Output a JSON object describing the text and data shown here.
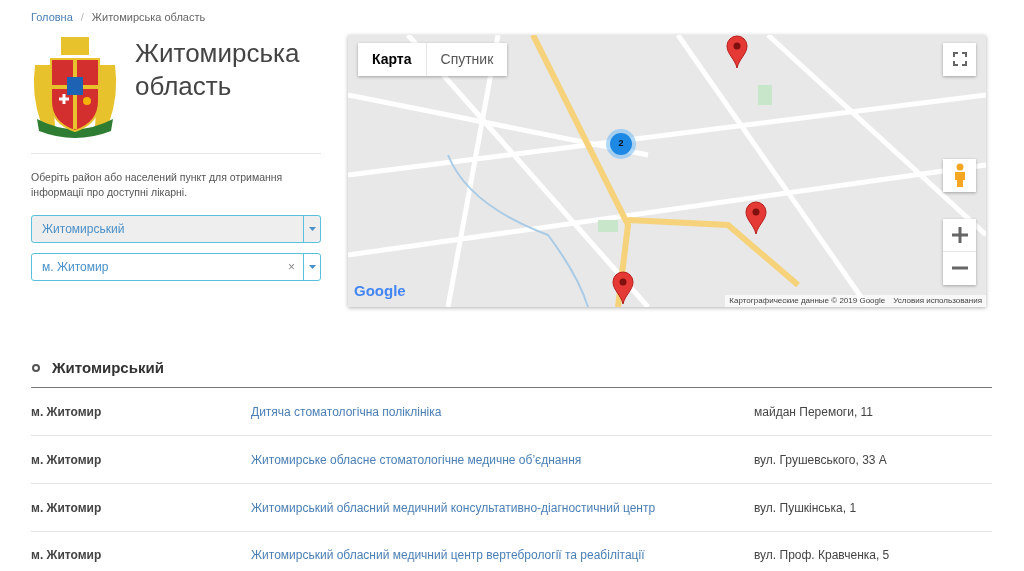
{
  "breadcrumb": {
    "separator": "/",
    "items": [
      {
        "label": "Головна",
        "link": true
      },
      {
        "label": "Житомирська область",
        "link": false
      }
    ]
  },
  "region": {
    "title": "Житомирська область",
    "hint": "Оберіть район або населений пункт для отримання інформації про доступні лікарні."
  },
  "selects": [
    {
      "value": "Житомирський",
      "disabled": true,
      "clearable": false
    },
    {
      "value": "м. Житомир",
      "disabled": false,
      "clearable": true,
      "clear_icon": "×"
    }
  ],
  "map": {
    "tabs": [
      {
        "label": "Карта",
        "selected": true
      },
      {
        "label": "Спутник",
        "selected": false
      }
    ],
    "cluster": "2",
    "logo": "Google",
    "attribution": "Картографические данные © 2019 Google",
    "terms": "Условия использования"
  },
  "section": {
    "title": "Житомирський",
    "rows": [
      {
        "city": "м. Житомир",
        "name": "Дитяча стоматологічна поліклініка",
        "address": "майдан Перемоги, 11"
      },
      {
        "city": "м. Житомир",
        "name": "Житомирське обласне стоматологічне медичне об’єднання",
        "address": "вул. Грушевського, 33 А"
      },
      {
        "city": "м. Житомир",
        "name": "Житомирський обласний медичний консультативно-діагностичний центр",
        "address": "вул. Пушкінська, 1"
      },
      {
        "city": "м. Житомир",
        "name": "Житомирський обласний медичний центр вертебрології та реабілітації",
        "address": "вул. Проф. Кравченка, 5"
      }
    ]
  }
}
